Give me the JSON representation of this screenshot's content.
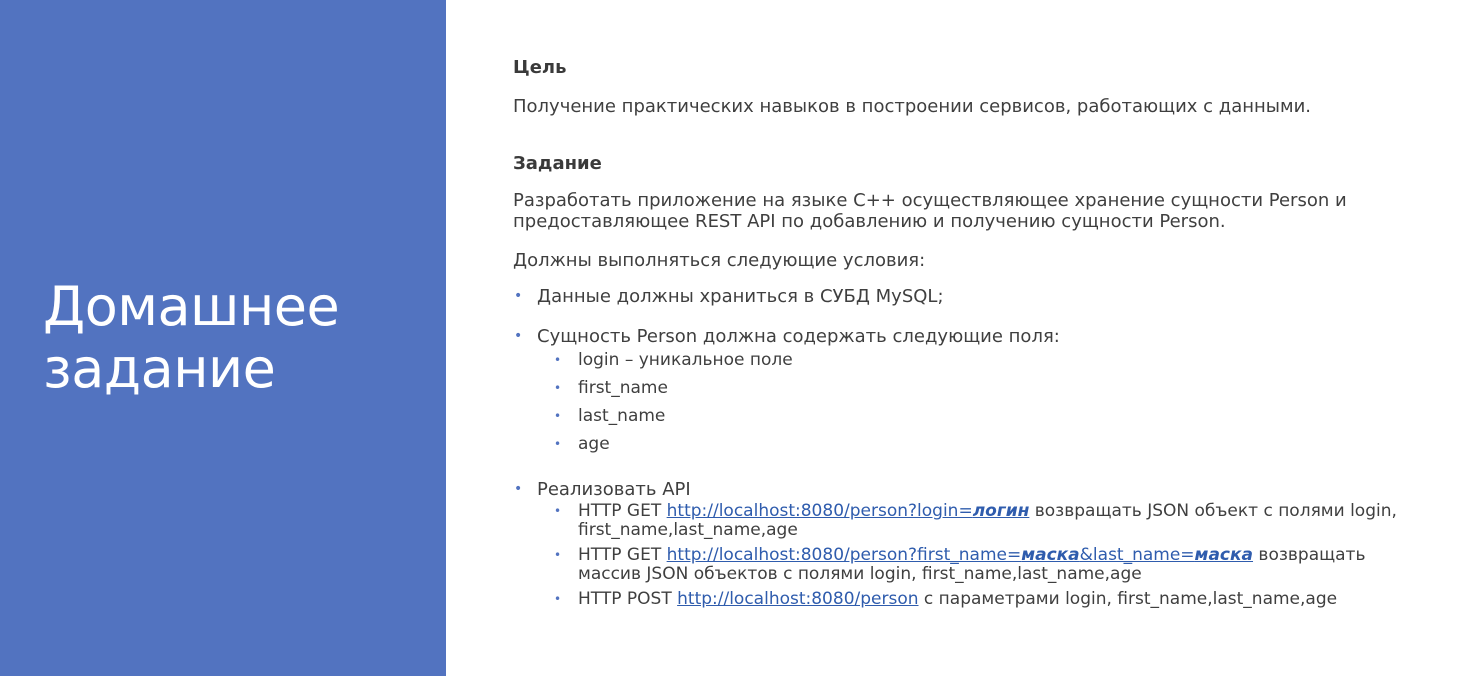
{
  "slide": {
    "title_line1": "Домашнее",
    "title_line2": "задание"
  },
  "goal": {
    "heading": "Цель",
    "text": "Получение практических навыков в построении сервисов, работающих с данными."
  },
  "task": {
    "heading": "Задание",
    "text": "Разработать приложение на языке C++ осуществляющее хранение сущности Person и предоставляющее REST API по добавлению и получению сущности Person.",
    "conditions_intro": "Должны выполняться следующие условия:",
    "bullet_db": "Данные должны храниться в СУБД MySQL;",
    "bullet_fields": "Сущность Person должна содержать следующие поля:",
    "fields": [
      "login – уникальное поле",
      "first_name",
      "last_name",
      "age"
    ],
    "bullet_api": "Реализовать API",
    "api": [
      {
        "prefix": "HTTP GET ",
        "link_text": "http://localhost:8080/person?login=",
        "link_var": "логин",
        "suffix": " возвращать JSON объект  с полями login, first_name,last_name,age"
      },
      {
        "prefix": "HTTP GET ",
        "link_text": "http://localhost:8080/person?first_name=",
        "link_var": "маска",
        "link_text2": "&last_name=",
        "link_var2": "маска",
        "suffix": " возвращать массив JSON объектов с полями login, first_name,last_name,age"
      },
      {
        "prefix": "HTTP POST ",
        "link_text": "http://localhost:8080/person",
        "suffix": " с параметрами login, first_name,last_name,age"
      }
    ]
  },
  "colors": {
    "panel": "#5273c0",
    "link": "#2f5cad",
    "text": "#3f3f3f"
  }
}
